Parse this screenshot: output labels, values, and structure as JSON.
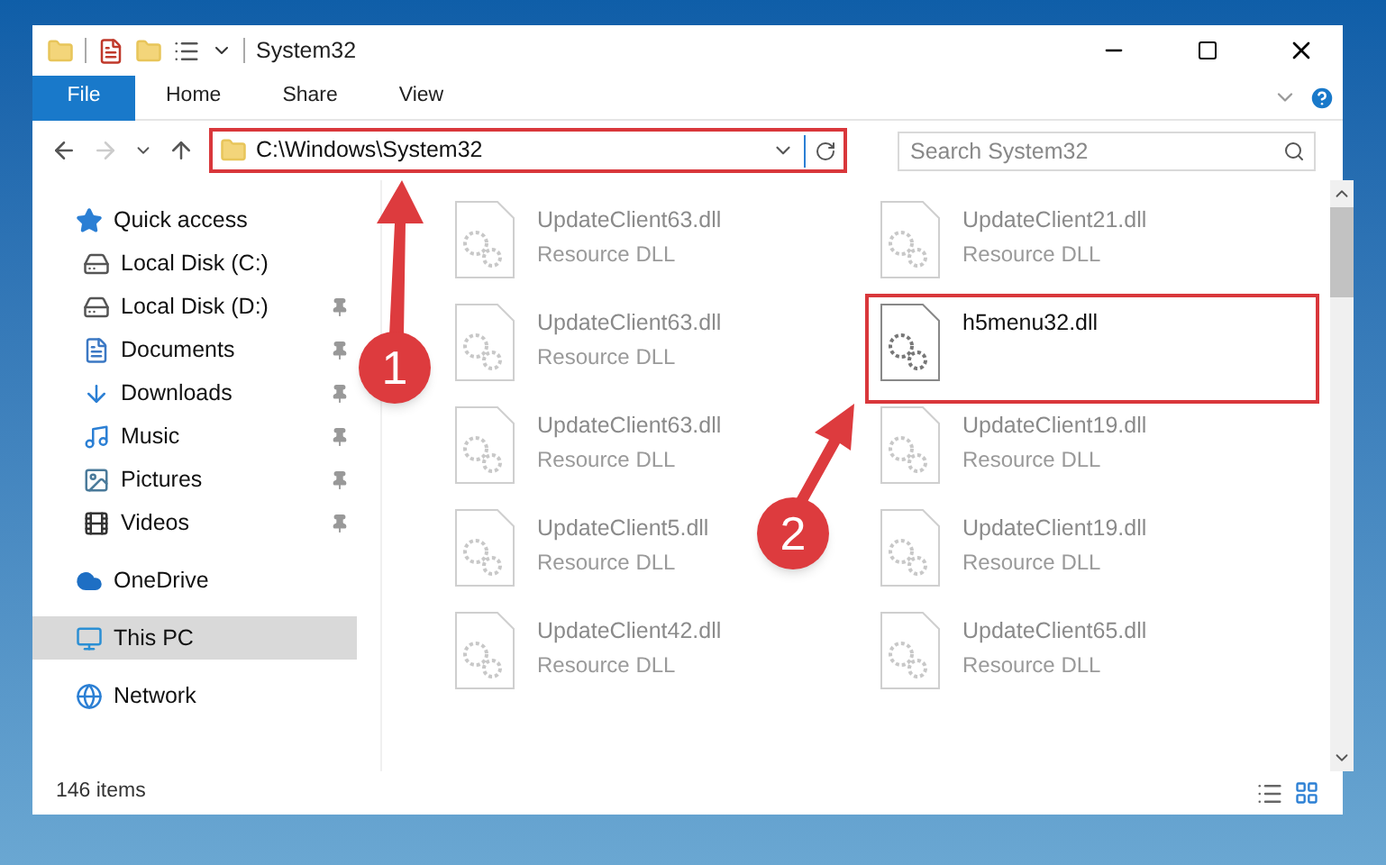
{
  "window": {
    "title": "System32"
  },
  "ribbon": {
    "tabs": [
      {
        "label": "File",
        "selected": true
      },
      {
        "label": "Home",
        "selected": false
      },
      {
        "label": "Share",
        "selected": false
      },
      {
        "label": "View",
        "selected": false
      }
    ]
  },
  "address": {
    "path": "C:\\Windows\\System32",
    "highlighted": true
  },
  "search": {
    "placeholder": "Search System32"
  },
  "sidebar": {
    "items": [
      {
        "label": "Quick access",
        "selected": false,
        "children": [
          {
            "label": "Local Disk (C:)",
            "pinned": false
          },
          {
            "label": "Local Disk (D:)",
            "pinned": true
          },
          {
            "label": "Documents",
            "pinned": true
          },
          {
            "label": "Downloads",
            "pinned": true
          },
          {
            "label": "Music",
            "pinned": true
          },
          {
            "label": "Pictures",
            "pinned": true
          },
          {
            "label": "Videos",
            "pinned": true
          }
        ]
      },
      {
        "label": "OneDrive",
        "selected": false
      },
      {
        "label": "This PC",
        "selected": true
      },
      {
        "label": "Network",
        "selected": false
      }
    ]
  },
  "files": [
    {
      "name": "UpdateClient63.dll",
      "type": "Resource DLL",
      "kind": "faded"
    },
    {
      "name": "UpdateClient21.dll",
      "type": "Resource DLL",
      "kind": "faded"
    },
    {
      "name": "UpdateClient63.dll",
      "type": "Resource DLL",
      "kind": "faded"
    },
    {
      "name": "h5menu32.dll",
      "kind": "highlighted"
    },
    {
      "name": "UpdateClient63.dll",
      "type": "Resource DLL",
      "kind": "faded"
    },
    {
      "name": "UpdateClient19.dll",
      "type": "Resource DLL",
      "kind": "faded"
    },
    {
      "name": "UpdateClient5.dll",
      "type": "Resource DLL",
      "kind": "faded"
    },
    {
      "name": "UpdateClient19.dll",
      "type": "Resource DLL",
      "kind": "faded"
    },
    {
      "name": "UpdateClient42.dll",
      "type": "Resource DLL",
      "kind": "faded"
    },
    {
      "name": "UpdateClient65.dll",
      "type": "Resource DLL",
      "kind": "faded"
    }
  ],
  "status_bar": {
    "count": "146 items"
  },
  "annotations": [
    {
      "label": "1"
    },
    {
      "label": "2"
    }
  ]
}
